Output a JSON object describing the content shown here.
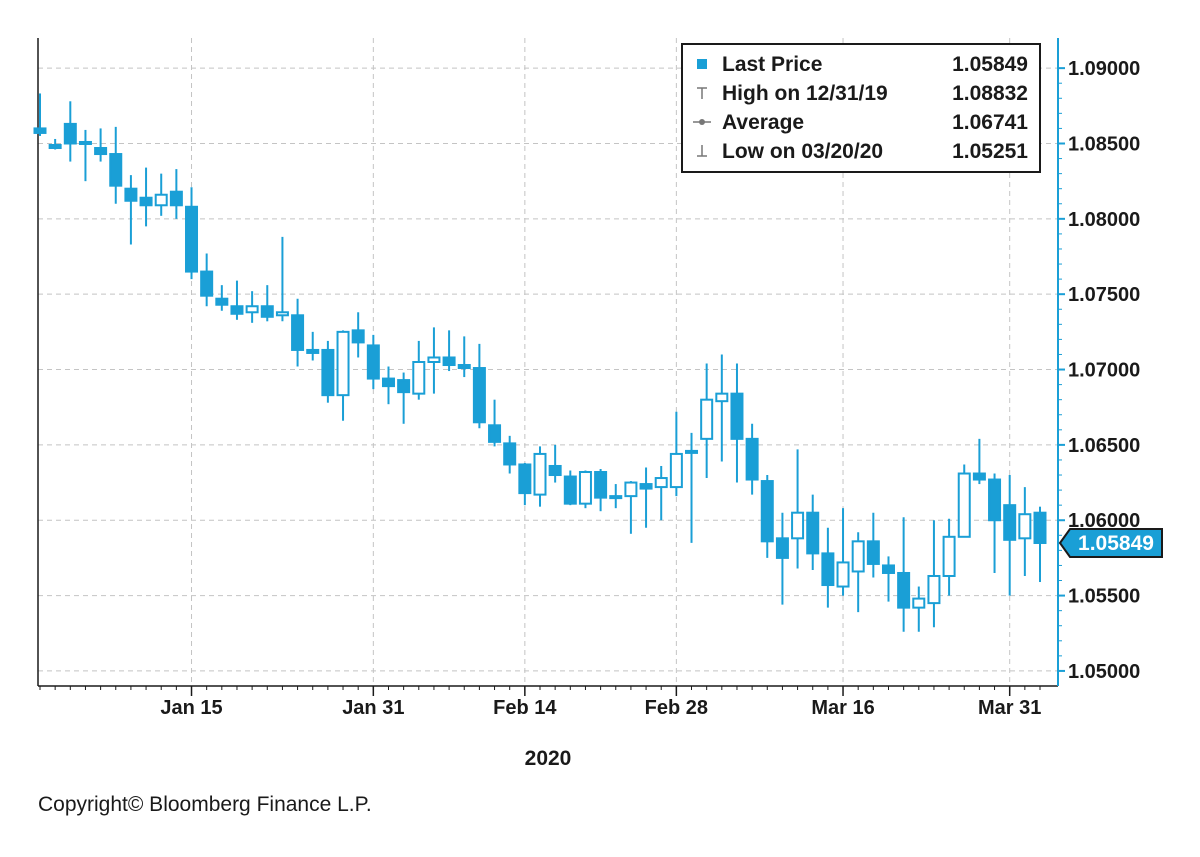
{
  "chart_data": {
    "type": "candlestick",
    "xlabel": "2020",
    "x_ticks": [
      "Jan 15",
      "Jan 31",
      "Feb 14",
      "Feb 28",
      "Mar 16",
      "Mar 31"
    ],
    "y_ticks": [
      "1.05000",
      "1.05500",
      "1.06000",
      "1.06500",
      "1.07000",
      "1.07500",
      "1.08000",
      "1.08500",
      "1.09000"
    ],
    "ylim": [
      1.049,
      1.092
    ],
    "grid": true,
    "y_axis_side": "right",
    "legend_position": "top-right",
    "color": "#1a9fd6",
    "legend": [
      {
        "icon": "square",
        "label": "Last Price",
        "value": "1.05849"
      },
      {
        "icon": "high",
        "label": "High on 12/31/19",
        "value": "1.08832"
      },
      {
        "icon": "average",
        "label": "Average",
        "value": "1.06741"
      },
      {
        "icon": "low",
        "label": "Low on 03/20/20",
        "value": "1.05251"
      }
    ],
    "last_price_tag": "1.05849",
    "last_price_value": 1.05849,
    "series": [
      {
        "date": "Dec 31",
        "open": 1.086,
        "high": 1.08832,
        "low": 1.0855,
        "close": 1.0857
      },
      {
        "date": "Jan 2",
        "open": 1.0849,
        "high": 1.0853,
        "low": 1.0846,
        "close": 1.0847
      },
      {
        "date": "Jan 3",
        "open": 1.0863,
        "high": 1.0878,
        "low": 1.0838,
        "close": 1.085
      },
      {
        "date": "Jan 6",
        "open": 1.085,
        "high": 1.0859,
        "low": 1.0825,
        "close": 1.0851
      },
      {
        "date": "Jan 7",
        "open": 1.0847,
        "high": 1.086,
        "low": 1.0838,
        "close": 1.0843
      },
      {
        "date": "Jan 8",
        "open": 1.0843,
        "high": 1.0861,
        "low": 1.081,
        "close": 1.0822
      },
      {
        "date": "Jan 9",
        "open": 1.082,
        "high": 1.0829,
        "low": 1.0783,
        "close": 1.0812
      },
      {
        "date": "Jan 10",
        "open": 1.0814,
        "high": 1.0834,
        "low": 1.0795,
        "close": 1.0809
      },
      {
        "date": "Jan 13",
        "open": 1.0809,
        "high": 1.083,
        "low": 1.0802,
        "close": 1.0816
      },
      {
        "date": "Jan 14",
        "open": 1.0818,
        "high": 1.0833,
        "low": 1.08,
        "close": 1.0809
      },
      {
        "date": "Jan 15",
        "open": 1.0808,
        "high": 1.0821,
        "low": 1.076,
        "close": 1.0765
      },
      {
        "date": "Jan 16",
        "open": 1.0765,
        "high": 1.0777,
        "low": 1.0742,
        "close": 1.0749
      },
      {
        "date": "Jan 17",
        "open": 1.0747,
        "high": 1.0756,
        "low": 1.0739,
        "close": 1.0743
      },
      {
        "date": "Jan 20",
        "open": 1.0742,
        "high": 1.0759,
        "low": 1.0733,
        "close": 1.0737
      },
      {
        "date": "Jan 21",
        "open": 1.0738,
        "high": 1.0752,
        "low": 1.0731,
        "close": 1.0742
      },
      {
        "date": "Jan 22",
        "open": 1.0742,
        "high": 1.0756,
        "low": 1.0732,
        "close": 1.0735
      },
      {
        "date": "Jan 23",
        "open": 1.0736,
        "high": 1.0788,
        "low": 1.0732,
        "close": 1.0738
      },
      {
        "date": "Jan 24",
        "open": 1.0736,
        "high": 1.0747,
        "low": 1.0702,
        "close": 1.0713
      },
      {
        "date": "Jan 27",
        "open": 1.0713,
        "high": 1.0725,
        "low": 1.0706,
        "close": 1.0711
      },
      {
        "date": "Jan 28",
        "open": 1.0713,
        "high": 1.0719,
        "low": 1.0678,
        "close": 1.0683
      },
      {
        "date": "Jan 29",
        "open": 1.0683,
        "high": 1.0726,
        "low": 1.0666,
        "close": 1.0725
      },
      {
        "date": "Jan 30",
        "open": 1.0726,
        "high": 1.0738,
        "low": 1.0708,
        "close": 1.0718
      },
      {
        "date": "Jan 31",
        "open": 1.0716,
        "high": 1.0723,
        "low": 1.0687,
        "close": 1.0694
      },
      {
        "date": "Feb 3",
        "open": 1.0694,
        "high": 1.0702,
        "low": 1.0677,
        "close": 1.0689
      },
      {
        "date": "Feb 4",
        "open": 1.0693,
        "high": 1.0698,
        "low": 1.0664,
        "close": 1.0685
      },
      {
        "date": "Feb 5",
        "open": 1.0684,
        "high": 1.0719,
        "low": 1.068,
        "close": 1.0705
      },
      {
        "date": "Feb 6",
        "open": 1.0705,
        "high": 1.0728,
        "low": 1.0684,
        "close": 1.0708
      },
      {
        "date": "Feb 7",
        "open": 1.0708,
        "high": 1.0726,
        "low": 1.0699,
        "close": 1.0703
      },
      {
        "date": "Feb 10",
        "open": 1.0703,
        "high": 1.0722,
        "low": 1.0695,
        "close": 1.0701
      },
      {
        "date": "Feb 11",
        "open": 1.0701,
        "high": 1.0717,
        "low": 1.0661,
        "close": 1.0665
      },
      {
        "date": "Feb 12",
        "open": 1.0663,
        "high": 1.068,
        "low": 1.0649,
        "close": 1.0652
      },
      {
        "date": "Feb 13",
        "open": 1.0651,
        "high": 1.0656,
        "low": 1.0631,
        "close": 1.0637
      },
      {
        "date": "Feb 14",
        "open": 1.0637,
        "high": 1.0638,
        "low": 1.061,
        "close": 1.0618
      },
      {
        "date": "Feb 17",
        "open": 1.0617,
        "high": 1.0649,
        "low": 1.0609,
        "close": 1.0644
      },
      {
        "date": "Feb 18",
        "open": 1.0636,
        "high": 1.065,
        "low": 1.0625,
        "close": 1.063
      },
      {
        "date": "Feb 19",
        "open": 1.0629,
        "high": 1.0633,
        "low": 1.061,
        "close": 1.0611
      },
      {
        "date": "Feb 20",
        "open": 1.0611,
        "high": 1.0633,
        "low": 1.0608,
        "close": 1.0632
      },
      {
        "date": "Feb 21",
        "open": 1.0632,
        "high": 1.0634,
        "low": 1.0606,
        "close": 1.0615
      },
      {
        "date": "Feb 24",
        "open": 1.0616,
        "high": 1.0624,
        "low": 1.0608,
        "close": 1.0615
      },
      {
        "date": "Feb 25",
        "open": 1.0616,
        "high": 1.0626,
        "low": 1.0591,
        "close": 1.0625
      },
      {
        "date": "Feb 26",
        "open": 1.0624,
        "high": 1.0635,
        "low": 1.0595,
        "close": 1.0621
      },
      {
        "date": "Feb 27",
        "open": 1.0622,
        "high": 1.0636,
        "low": 1.06,
        "close": 1.0628
      },
      {
        "date": "Feb 28",
        "open": 1.0622,
        "high": 1.0672,
        "low": 1.0616,
        "close": 1.0644
      },
      {
        "date": "Mar 2",
        "open": 1.0645,
        "high": 1.0658,
        "low": 1.0585,
        "close": 1.0646
      },
      {
        "date": "Mar 3",
        "open": 1.0654,
        "high": 1.0704,
        "low": 1.0628,
        "close": 1.068
      },
      {
        "date": "Mar 4",
        "open": 1.0679,
        "high": 1.071,
        "low": 1.0639,
        "close": 1.0684
      },
      {
        "date": "Mar 5",
        "open": 1.0684,
        "high": 1.0704,
        "low": 1.0625,
        "close": 1.0654
      },
      {
        "date": "Mar 6",
        "open": 1.0654,
        "high": 1.0664,
        "low": 1.0617,
        "close": 1.0627
      },
      {
        "date": "Mar 9",
        "open": 1.0626,
        "high": 1.063,
        "low": 1.0575,
        "close": 1.0586
      },
      {
        "date": "Mar 10",
        "open": 1.0588,
        "high": 1.0605,
        "low": 1.0544,
        "close": 1.0575
      },
      {
        "date": "Mar 11",
        "open": 1.0588,
        "high": 1.0647,
        "low": 1.0568,
        "close": 1.0605
      },
      {
        "date": "Mar 12",
        "open": 1.0605,
        "high": 1.0617,
        "low": 1.0567,
        "close": 1.0578
      },
      {
        "date": "Mar 13",
        "open": 1.0578,
        "high": 1.0595,
        "low": 1.0542,
        "close": 1.0557
      },
      {
        "date": "Mar 16",
        "open": 1.0556,
        "high": 1.0608,
        "low": 1.055,
        "close": 1.0572
      },
      {
        "date": "Mar 17",
        "open": 1.0566,
        "high": 1.0592,
        "low": 1.0539,
        "close": 1.0586
      },
      {
        "date": "Mar 18",
        "open": 1.0586,
        "high": 1.0605,
        "low": 1.0562,
        "close": 1.0571
      },
      {
        "date": "Mar 19",
        "open": 1.057,
        "high": 1.0576,
        "low": 1.0546,
        "close": 1.0565
      },
      {
        "date": "Mar 20",
        "open": 1.0565,
        "high": 1.0602,
        "low": 1.0526,
        "close": 1.0542
      },
      {
        "date": "Mar 23",
        "open": 1.0542,
        "high": 1.0556,
        "low": 1.0526,
        "close": 1.0548
      },
      {
        "date": "Mar 24",
        "open": 1.0545,
        "high": 1.06,
        "low": 1.0529,
        "close": 1.0563
      },
      {
        "date": "Mar 25",
        "open": 1.0563,
        "high": 1.0601,
        "low": 1.055,
        "close": 1.0589
      },
      {
        "date": "Mar 26",
        "open": 1.0589,
        "high": 1.0637,
        "low": 1.0589,
        "close": 1.0631
      },
      {
        "date": "Mar 27",
        "open": 1.0631,
        "high": 1.0654,
        "low": 1.0624,
        "close": 1.0627
      },
      {
        "date": "Mar 30",
        "open": 1.0627,
        "high": 1.0631,
        "low": 1.0565,
        "close": 1.06
      },
      {
        "date": "Mar 31",
        "open": 1.061,
        "high": 1.063,
        "low": 1.055,
        "close": 1.0587
      },
      {
        "date": "Apr 1",
        "open": 1.0588,
        "high": 1.0622,
        "low": 1.0563,
        "close": 1.0604
      },
      {
        "date": "Apr 2",
        "open": 1.0605,
        "high": 1.0609,
        "low": 1.0559,
        "close": 1.05849
      }
    ]
  },
  "footer": {
    "copyright": "Copyright© Bloomberg Finance L.P."
  }
}
